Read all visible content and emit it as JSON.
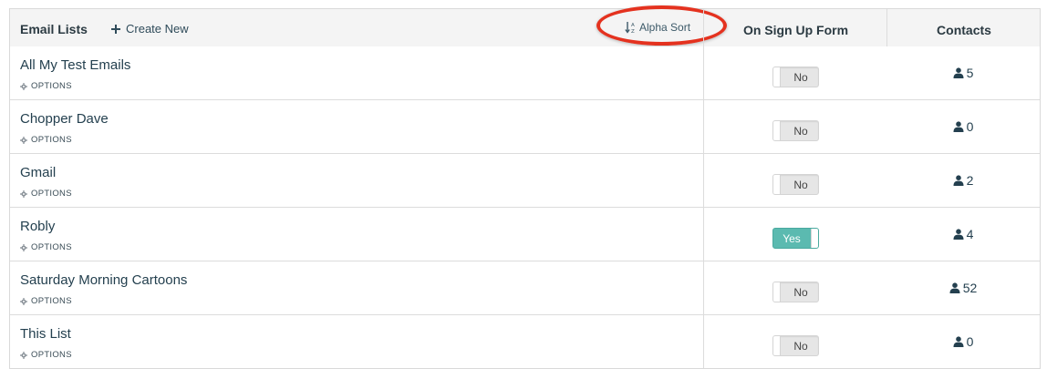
{
  "header": {
    "title": "Email Lists",
    "create_new": "Create New",
    "alpha_sort": "Alpha Sort",
    "signup_col": "On Sign Up Form",
    "contacts_col": "Contacts"
  },
  "options_label": "OPTIONS",
  "colors": {
    "toggle_on": "#5bbab0",
    "annotation": "#e4321f",
    "text": "#24404f"
  },
  "rows": [
    {
      "name": "All My Test Emails",
      "signup": "No",
      "signup_on": false,
      "contacts": "5"
    },
    {
      "name": "Chopper Dave",
      "signup": "No",
      "signup_on": false,
      "contacts": "0"
    },
    {
      "name": "Gmail",
      "signup": "No",
      "signup_on": false,
      "contacts": "2"
    },
    {
      "name": "Robly",
      "signup": "Yes",
      "signup_on": true,
      "contacts": "4"
    },
    {
      "name": "Saturday Morning Cartoons",
      "signup": "No",
      "signup_on": false,
      "contacts": "52"
    },
    {
      "name": "This List",
      "signup": "No",
      "signup_on": false,
      "contacts": "0"
    }
  ]
}
